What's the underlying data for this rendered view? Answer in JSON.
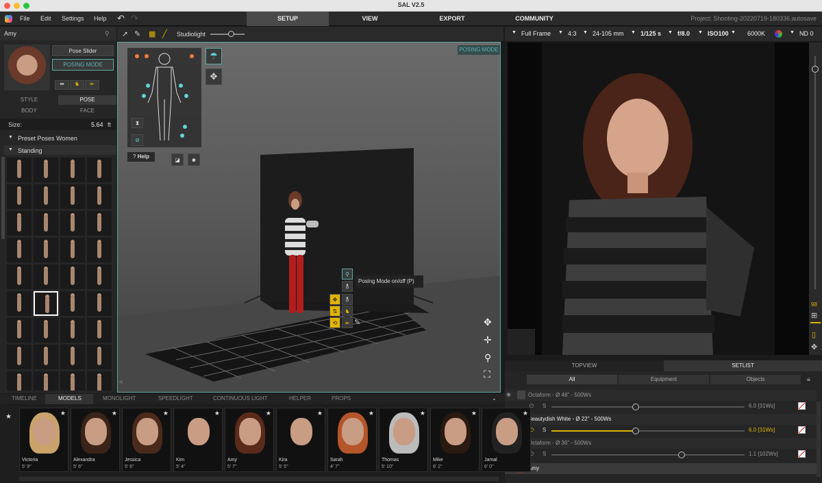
{
  "window": {
    "title": "SAL V2.5"
  },
  "menu": {
    "items": [
      "File",
      "Edit",
      "Settings",
      "Help"
    ]
  },
  "main_tabs": [
    "SETUP",
    "VIEW",
    "EXPORT",
    "COMMUNITY"
  ],
  "project": "Project: Shooting-20220719-180336.autosave",
  "left": {
    "character_name": "Amy",
    "pose_slider_label": "Pose Slider",
    "posing_mode_label": "POSING MODE",
    "tabs": [
      "STYLE",
      "POSE",
      "BODY",
      "FACE"
    ],
    "size_label": "Size:",
    "size_value": "5.64",
    "size_unit": "ft",
    "preset_header": "Preset Poses Women",
    "standing_header": "Standing"
  },
  "viewport": {
    "studio_label": "Studiolight",
    "posing_mode_badge": "POSING MODE",
    "help_label": "Help",
    "tooltip": "Posing Mode on/off (P)"
  },
  "camera": {
    "sensor": "Full Frame",
    "ratio": "4:3",
    "lens": "24-105 mm",
    "shutter": "1/125 s",
    "aperture": "f/8.0",
    "iso": "ISO100",
    "wb": "6000K",
    "nd": "ND 0",
    "side_value": "98"
  },
  "setlist": {
    "tabs": [
      "TOPVIEW",
      "SETLIST"
    ],
    "filters": [
      "All",
      "Equipment",
      "Objects"
    ],
    "rows": [
      {
        "name": "Octaform - Ø 48\" - 500Ws",
        "value": "6.0 [31Ws]"
      },
      {
        "name": "Beautydish White - Ø 22\" - 500Ws",
        "value": "6.0 [31Ws]"
      },
      {
        "name": "Octaform - Ø 36\" - 500Ws",
        "value": "1.1 [102Ws]"
      }
    ],
    "s_label": "S",
    "amy_row": "Amy"
  },
  "bottom_tabs": [
    "TIMELINE",
    "MODELS",
    "MONOLIGHT",
    "SPEEDLIGHT",
    "CONTINUOUS LIGHT",
    "HELPER",
    "PROPS"
  ],
  "models": [
    {
      "name": "Victoria",
      "height": "5' 9\""
    },
    {
      "name": "Alexandra",
      "height": "5' 6\""
    },
    {
      "name": "Jessica",
      "height": "5' 6\""
    },
    {
      "name": "Kim",
      "height": "5' 4\""
    },
    {
      "name": "Amy",
      "height": "5' 7\""
    },
    {
      "name": "Kira",
      "height": "5' 5\""
    },
    {
      "name": "Sarah",
      "height": "4' 7\""
    },
    {
      "name": "Thomas",
      "height": "5' 10\""
    },
    {
      "name": "Mike",
      "height": "6' 2\""
    },
    {
      "name": "Jamal",
      "height": "6' 0\""
    }
  ]
}
